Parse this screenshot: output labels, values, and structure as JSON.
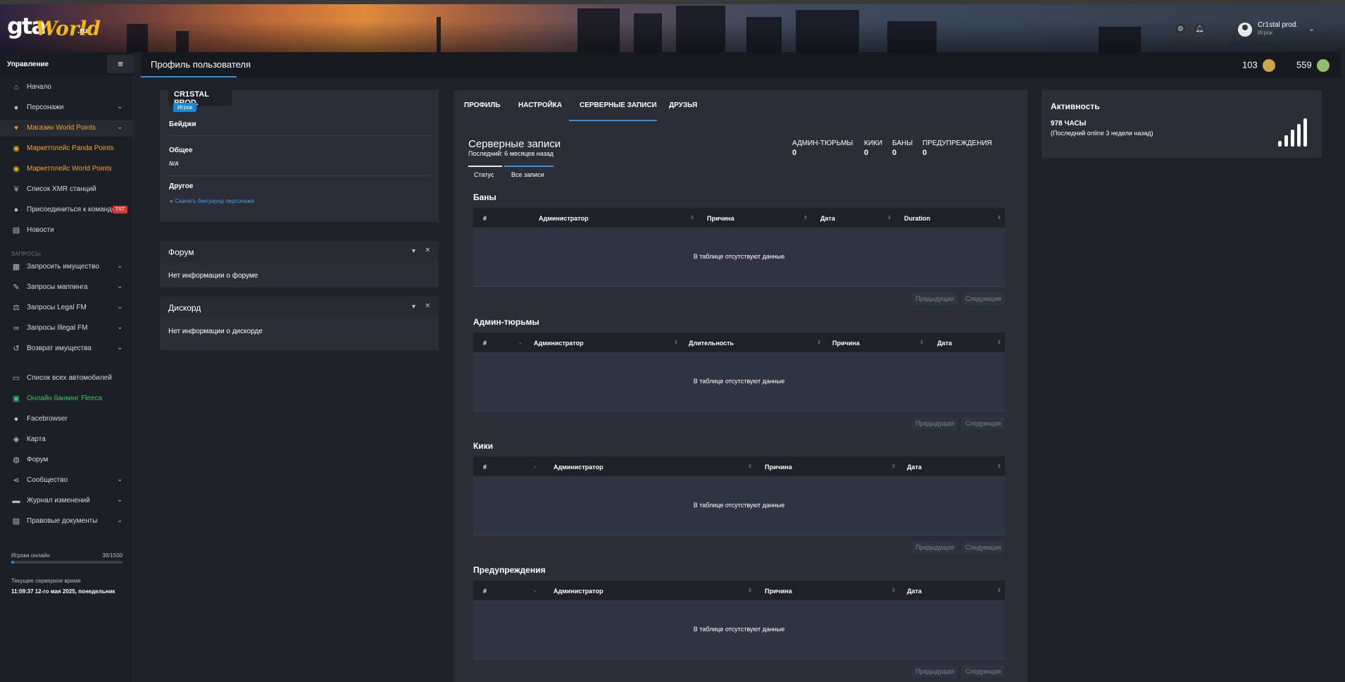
{
  "header": {
    "logo": {
      "gta": "gta",
      "world": "World",
      "ru": ".ru"
    },
    "icons": [
      "gear-icon",
      "bell-icon"
    ],
    "user": {
      "name": "Cr1stal prod.",
      "role": "Игрок"
    }
  },
  "sidebar": {
    "title": "Управление",
    "items_top": [
      {
        "label": "Начало",
        "icon": "home-icon",
        "chevron": false,
        "style": "normal"
      },
      {
        "label": "Персонажи",
        "icon": "user-icon",
        "chevron": true,
        "style": "normal"
      },
      {
        "label": "Магазин World Points",
        "icon": "cart-icon",
        "chevron": true,
        "style": "orange-active"
      },
      {
        "label": "Маркетплейс Panda Points",
        "icon": "coins-icon",
        "chevron": false,
        "style": "orange"
      },
      {
        "label": "Маркетплейс World Points",
        "icon": "coins-icon",
        "chevron": false,
        "style": "orange"
      },
      {
        "label": "Список XMR станций",
        "icon": "antenna-icon",
        "chevron": false,
        "style": "normal"
      },
      {
        "label": "Присоединиться к команде!",
        "icon": "user-plus-icon",
        "chevron": false,
        "style": "normal",
        "badge": "TST"
      },
      {
        "label": "Новости",
        "icon": "news-icon",
        "chevron": false,
        "style": "normal"
      }
    ],
    "section_label": "ЗАПРОСЫ",
    "items_requests": [
      {
        "label": "Запросить имущество",
        "icon": "building-icon",
        "chevron": true
      },
      {
        "label": "Запросы маппинга",
        "icon": "brush-icon",
        "chevron": true
      },
      {
        "label": "Запросы Legal FM",
        "icon": "scale-icon",
        "chevron": true
      },
      {
        "label": "Запросы Illegal FM",
        "icon": "mask-icon",
        "chevron": true
      },
      {
        "label": "Возврат имущества",
        "icon": "undo-icon",
        "chevron": true
      }
    ],
    "items_bottom": [
      {
        "label": "Список всех автомобилей",
        "icon": "car-icon",
        "chevron": false,
        "style": "normal"
      },
      {
        "label": "Онлайн банкинг Fleeca",
        "icon": "bank-icon",
        "chevron": false,
        "style": "green"
      },
      {
        "label": "Facebrowser",
        "icon": "users-icon",
        "chevron": false,
        "style": "normal"
      },
      {
        "label": "Карта",
        "icon": "map-icon",
        "chevron": false,
        "style": "normal"
      },
      {
        "label": "Форум",
        "icon": "forum-icon",
        "chevron": false,
        "style": "normal"
      },
      {
        "label": "Сообщество",
        "icon": "share-icon",
        "chevron": true,
        "style": "normal"
      },
      {
        "label": "Журнал изменений",
        "icon": "log-icon",
        "chevron": true,
        "style": "normal"
      },
      {
        "label": "Правовые документы",
        "icon": "doc-icon",
        "chevron": true,
        "style": "normal"
      }
    ],
    "online": {
      "label": "Игроки онлайн",
      "value": "38/1500",
      "fraction": 0.025
    },
    "server_time": {
      "label": "Текущее серверное время",
      "value": "11:09:37 12-го мая 2025, понедельник"
    }
  },
  "titlebar": {
    "title": "Профиль пользователя",
    "coins": [
      {
        "value": "103",
        "color": "#c9a84a"
      },
      {
        "value": "559",
        "color": "#8fbf6a"
      }
    ]
  },
  "profile_card": {
    "name": "CR1STAL PROD.",
    "role": "Игрок",
    "badges_label": "Бейджи",
    "general_label": "Общее",
    "general_value": "N/A",
    "other_label": "Другое",
    "download_link": "Скачать бекграунд персонажа"
  },
  "forum_widget": {
    "title": "Форум",
    "body": "Нет информации о форуме"
  },
  "discord_widget": {
    "title": "Дискорд",
    "body": "Нет информации о дискорде"
  },
  "main": {
    "tabs": [
      "ПРОФИЛЬ",
      "НАСТРОЙКА",
      "СЕРВЕРНЫЕ ЗАПИСИ",
      "ДРУЗЬЯ"
    ],
    "active_tab": 2,
    "title": "Серверные записи",
    "subtitle": "Последний: 6 месяцев назад",
    "stats": [
      {
        "label": "АДМИН-ТЮРЬМЫ",
        "value": "0"
      },
      {
        "label": "КИКИ",
        "value": "0"
      },
      {
        "label": "БАНЫ",
        "value": "0"
      },
      {
        "label": "ПРЕДУПРЕЖДЕНИЯ",
        "value": "0"
      }
    ],
    "subtabs": [
      "Статус",
      "Все записи"
    ],
    "empty_text": "В таблице отсутствуют данные",
    "prev_label": "Предыдущая",
    "next_label": "Следующая",
    "tables": [
      {
        "title": "Баны",
        "columns": [
          "#",
          "Администратор",
          "Причина",
          "Дата",
          "Duration"
        ]
      },
      {
        "title": "Админ-тюрьмы",
        "columns": [
          "#",
          "Администратор",
          "Длительность",
          "Причина",
          "Дата"
        ]
      },
      {
        "title": "Кики",
        "columns": [
          "#",
          "Администратор",
          "Причина",
          "Дата"
        ]
      },
      {
        "title": "Предупреждения",
        "columns": [
          "#",
          "Администратор",
          "Причина",
          "Дата"
        ]
      }
    ]
  },
  "activity": {
    "title": "Активность",
    "hours": "978 ЧАСЫ",
    "last_online": "(Последний online 3 недели назад)"
  }
}
